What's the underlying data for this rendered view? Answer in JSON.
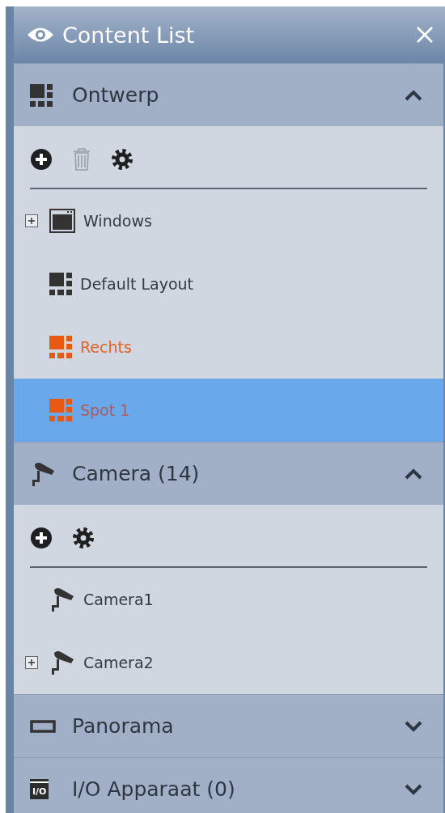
{
  "window": {
    "title": "Content List"
  },
  "sections": [
    {
      "title": "Ontwerp",
      "kind": "layout",
      "expanded": true,
      "tools": [
        {
          "kind": "add",
          "disabled": false
        },
        {
          "kind": "delete",
          "disabled": true
        },
        {
          "kind": "settings",
          "disabled": false
        }
      ],
      "items": [
        {
          "label": "Windows",
          "kind": "window",
          "expandable": true,
          "highlighted": false,
          "selected": false
        },
        {
          "label": "Default Layout",
          "kind": "layout",
          "expandable": false,
          "highlighted": false,
          "selected": false
        },
        {
          "label": "Rechts",
          "kind": "layout",
          "expandable": false,
          "highlighted": true,
          "selected": false
        },
        {
          "label": "Spot 1",
          "kind": "layout",
          "expandable": false,
          "highlighted": true,
          "selected": true
        }
      ]
    },
    {
      "title": "Camera (14)",
      "kind": "camera",
      "expanded": true,
      "tools": [
        {
          "kind": "add",
          "disabled": false
        },
        {
          "kind": "settings",
          "disabled": false
        }
      ],
      "items": [
        {
          "label": "Camera1",
          "kind": "camera",
          "expandable": false,
          "highlighted": false,
          "selected": false
        },
        {
          "label": "Camera2",
          "kind": "camera",
          "expandable": true,
          "highlighted": false,
          "selected": false
        }
      ]
    },
    {
      "title": "Panorama",
      "kind": "panorama",
      "expanded": false
    },
    {
      "title": "I/O Apparaat (0)",
      "kind": "io",
      "icon_text": "I/O",
      "expanded": false
    }
  ]
}
